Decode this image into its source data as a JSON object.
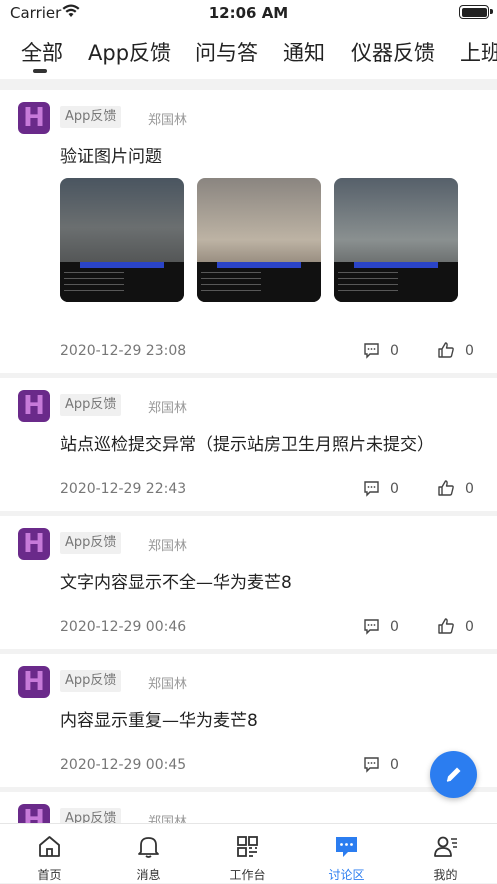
{
  "status_bar": {
    "carrier": "Carrier",
    "time": "12:06 AM"
  },
  "tabs": [
    {
      "label": "全部",
      "active": true
    },
    {
      "label": "App反馈"
    },
    {
      "label": "问与答"
    },
    {
      "label": "通知"
    },
    {
      "label": "仪器反馈"
    },
    {
      "label": "上班"
    }
  ],
  "posts": [
    {
      "tag": "App反馈",
      "author": "郑国林",
      "title": "验证图片问题",
      "date": "2020-12-29 23:08",
      "comments": "0",
      "likes": "0",
      "has_images": true
    },
    {
      "tag": "App反馈",
      "author": "郑国林",
      "title": "站点巡检提交异常（提示站房卫生月照片未提交）",
      "date": "2020-12-29 22:43",
      "comments": "0",
      "likes": "0"
    },
    {
      "tag": "App反馈",
      "author": "郑国林",
      "title": "文字内容显示不全—华为麦芒8",
      "date": "2020-12-29 00:46",
      "comments": "0",
      "likes": "0"
    },
    {
      "tag": "App反馈",
      "author": "郑国林",
      "title": "内容显示重复—华为麦芒8",
      "date": "2020-12-29 00:45",
      "comments": "0"
    },
    {
      "tag": "App反馈",
      "author": "郑国林"
    }
  ],
  "bottom_nav": [
    {
      "label": "首页",
      "icon": "home-icon"
    },
    {
      "label": "消息",
      "icon": "bell-icon"
    },
    {
      "label": "工作台",
      "icon": "grid-icon"
    },
    {
      "label": "讨论区",
      "icon": "chat-icon",
      "active": true
    },
    {
      "label": "我的",
      "icon": "user-icon"
    }
  ],
  "colors": {
    "accent": "#2b7df0",
    "avatar": "#6a2a8a"
  },
  "fab_icon": "pencil-icon"
}
